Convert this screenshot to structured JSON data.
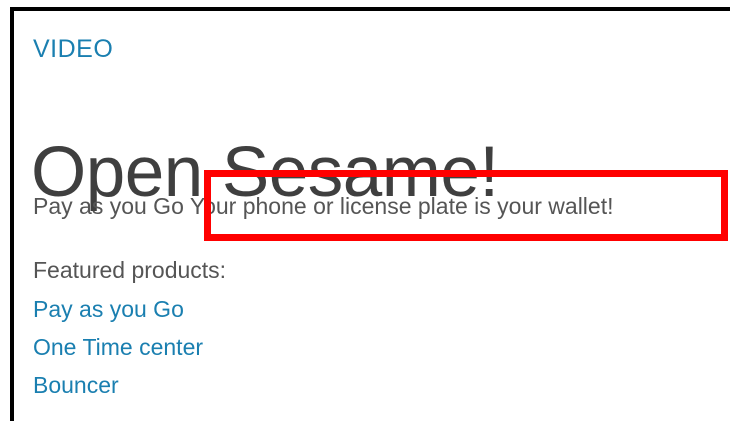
{
  "section": {
    "category": "VIDEO",
    "title": "Open Sesame!",
    "subtitle_part1": "Pay as you Go",
    "subtitle_part2": "Your phone or license plate is your wallet!"
  },
  "featured": {
    "label": "Featured products:",
    "products": [
      "Pay as you Go",
      "One Time center",
      "Bouncer"
    ]
  },
  "colors": {
    "link": "#1a7fb0",
    "text": "#555555",
    "title": "#3f3f3f",
    "highlight": "#ff0000"
  }
}
